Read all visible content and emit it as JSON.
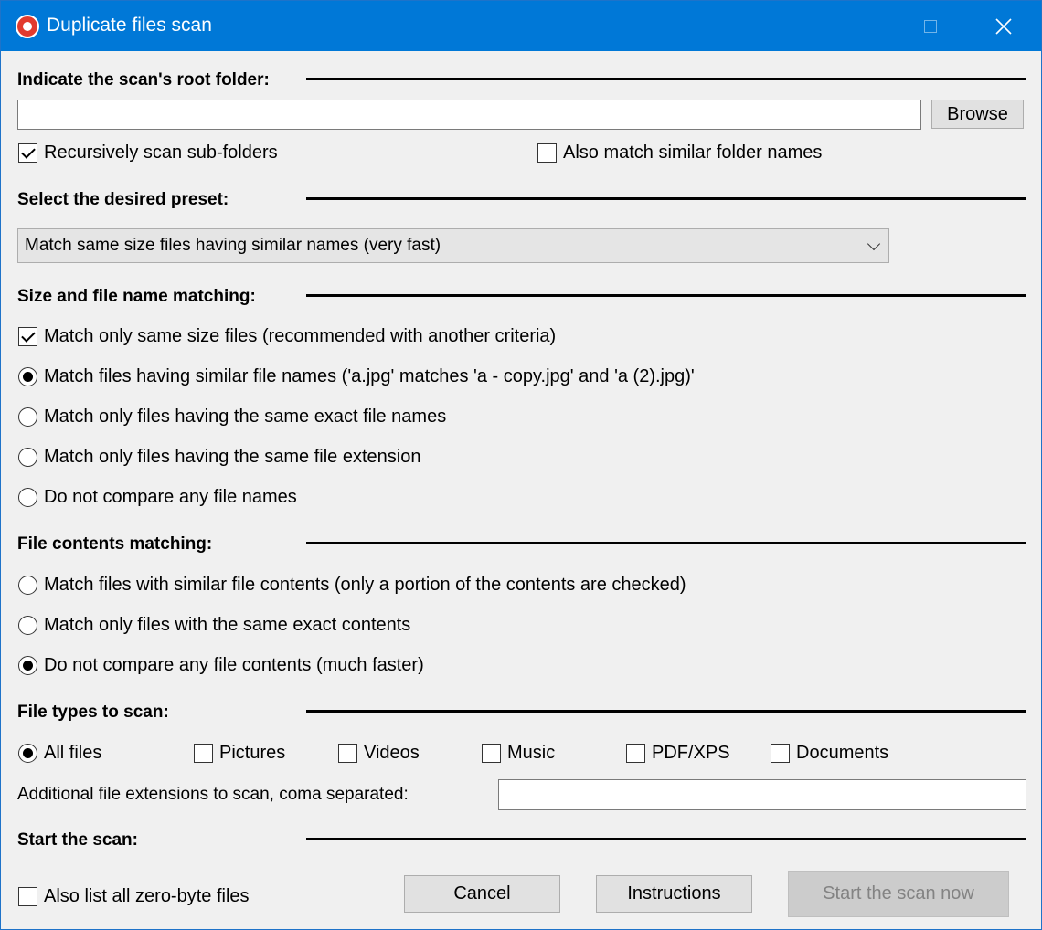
{
  "window": {
    "title": "Duplicate files scan"
  },
  "root_folder": {
    "heading": "Indicate the scan's root folder:",
    "path_value": "",
    "browse_label": "Browse",
    "recursive_label": "Recursively scan sub-folders",
    "recursive_checked": true,
    "similar_folders_label": "Also match similar folder names",
    "similar_folders_checked": false
  },
  "preset": {
    "heading": "Select the desired preset:",
    "selected": "Match same size files having similar names (very fast)"
  },
  "size_name": {
    "heading": "Size and file name matching:",
    "same_size_label": "Match only same size files (recommended with another criteria)",
    "same_size_checked": true,
    "options": [
      "Match files having similar file names ('a.jpg' matches 'a - copy.jpg' and 'a (2).jpg)'",
      "Match only files having the same exact file names",
      "Match only files having the same file extension",
      "Do not compare any file names"
    ],
    "selected_index": 0
  },
  "contents": {
    "heading": "File contents matching:",
    "options": [
      "Match files with similar file contents (only a portion of the contents are checked)",
      "Match only files with the same exact contents",
      "Do not compare any file contents (much faster)"
    ],
    "selected_index": 2
  },
  "file_types": {
    "heading": "File types to scan:",
    "all_files_label": "All files",
    "all_files_selected": true,
    "types": [
      {
        "label": "Pictures",
        "checked": false
      },
      {
        "label": "Videos",
        "checked": false
      },
      {
        "label": "Music",
        "checked": false
      },
      {
        "label": "PDF/XPS",
        "checked": false
      },
      {
        "label": "Documents",
        "checked": false
      }
    ],
    "extensions_label": "Additional file extensions to scan, coma separated:",
    "extensions_value": ""
  },
  "start": {
    "heading": "Start the scan:",
    "zero_byte_label": "Also list all zero-byte files",
    "zero_byte_checked": false,
    "cancel_label": "Cancel",
    "instructions_label": "Instructions",
    "start_label": "Start the scan now"
  }
}
